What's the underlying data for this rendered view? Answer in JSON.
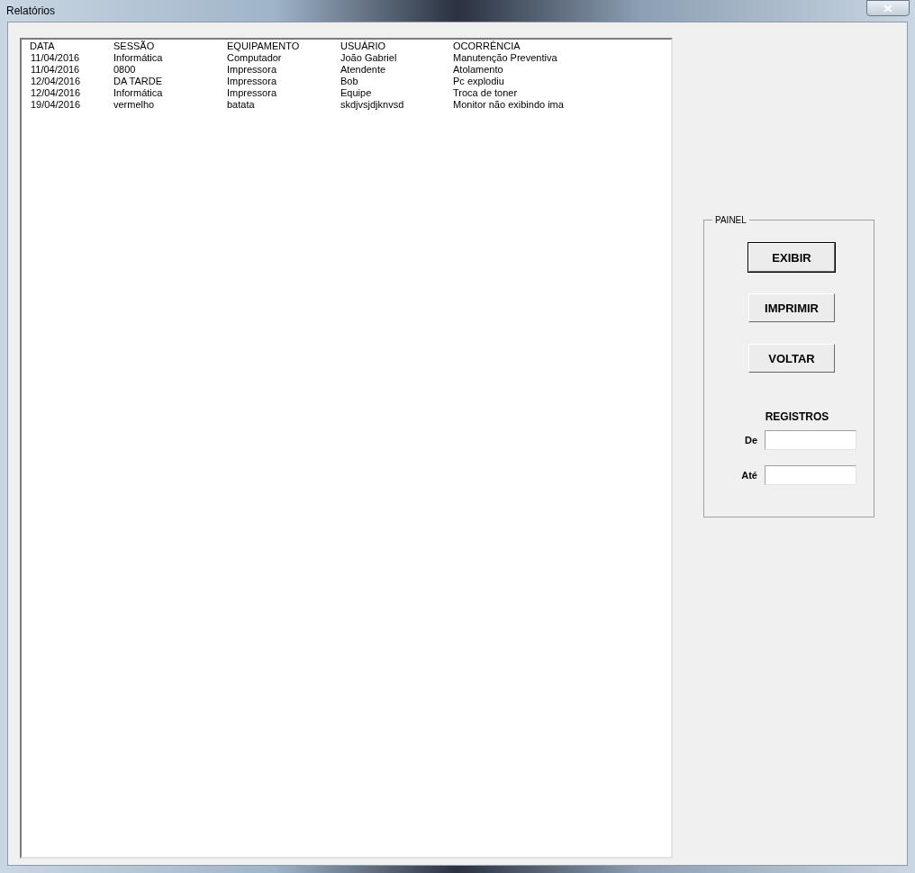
{
  "window": {
    "title": "Relatórios"
  },
  "table": {
    "columns": [
      "DATA",
      "SESSÃO",
      "EQUIPAMENTO",
      "USUÁRIO",
      "OCORRÊNCIA"
    ],
    "rows": [
      [
        "11/04/2016",
        "Informática",
        "Computador",
        "João Gabriel",
        "Manutenção Preventiva"
      ],
      [
        "11/04/2016",
        "0800",
        "Impressora",
        "Atendente",
        "Atolamento"
      ],
      [
        "12/04/2016",
        "DA TARDE",
        "Impressora",
        "Bob",
        "Pc explodiu"
      ],
      [
        "12/04/2016",
        "Informática",
        "Impressora",
        "Equipe",
        "Troca de toner"
      ],
      [
        "19/04/2016",
        "vermelho",
        "batata",
        "skdjvsjdjknvsd",
        "Monitor não exibindo ima"
      ]
    ]
  },
  "panel": {
    "title": "PAINEL",
    "buttons": [
      {
        "label": "EXIBIR",
        "focused": true
      },
      {
        "label": "IMPRIMIR",
        "focused": false
      },
      {
        "label": "VOLTAR",
        "focused": false
      }
    ],
    "registros": {
      "heading": "REGISTROS",
      "fields": [
        {
          "label": "De"
        },
        {
          "label": "Até"
        }
      ]
    }
  }
}
